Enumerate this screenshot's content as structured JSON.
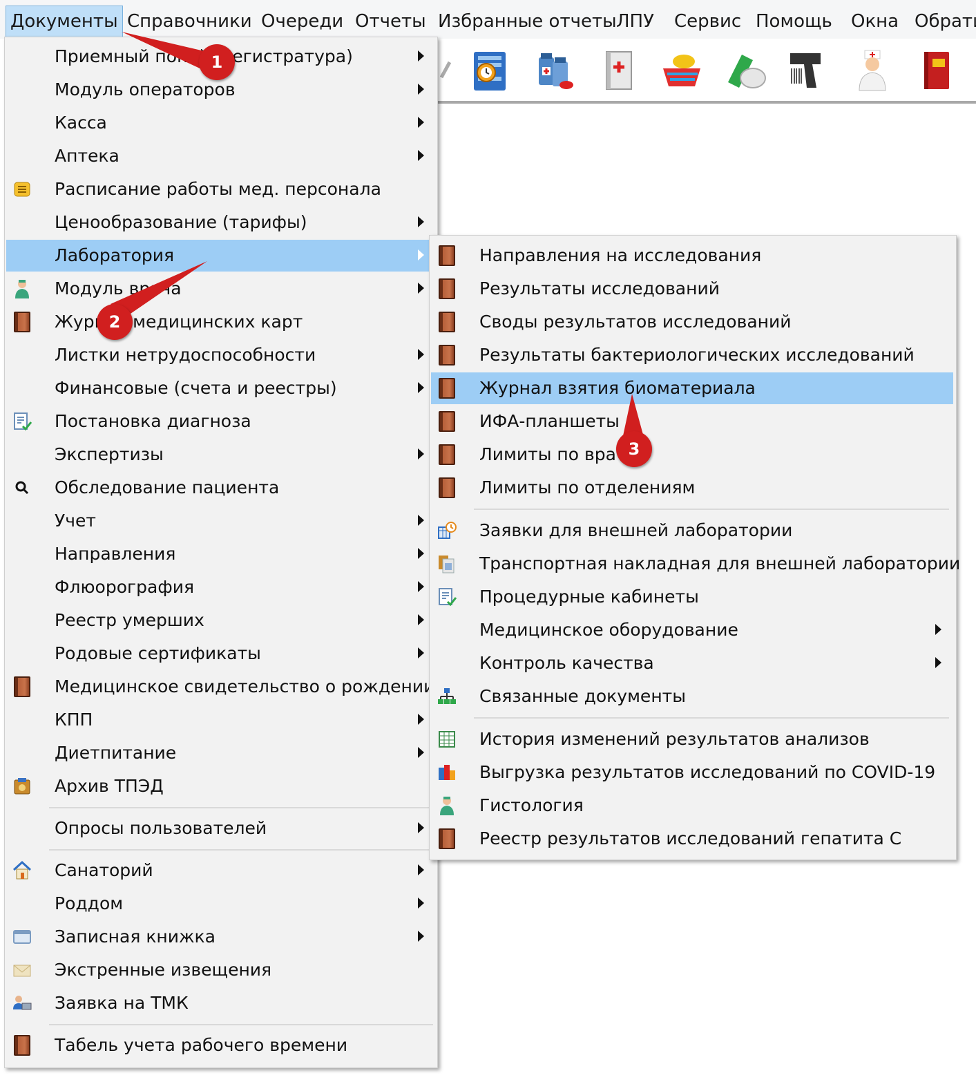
{
  "menubar": {
    "items": [
      "Документы",
      "Справочники",
      "Очереди",
      "Отчеты",
      "Избранные отчеты",
      "ЛПУ",
      "Сервис",
      "Помощь",
      "Окна",
      "Обрати"
    ]
  },
  "toolbar": {
    "icons": [
      "schedule-clock-icon",
      "medicine-bottles-icon",
      "medical-book-icon",
      "basket-pills-icon",
      "pills-icon",
      "barcode-scanner-icon",
      "nurse-icon",
      "red-document-icon"
    ]
  },
  "main_menu": {
    "items": [
      {
        "label": "Приемный покой (регистратура)",
        "icon": "",
        "submenu": true
      },
      {
        "label": "Модуль операторов",
        "icon": "",
        "submenu": true
      },
      {
        "label": "Касса",
        "icon": "",
        "submenu": true
      },
      {
        "label": "Аптека",
        "icon": "",
        "submenu": true
      },
      {
        "label": "Расписание работы мед. персонала",
        "icon": "schedule-list-icon",
        "submenu": false
      },
      {
        "label": "Ценообразование (тарифы)",
        "icon": "",
        "submenu": true
      },
      {
        "label": "Лаборатория",
        "icon": "",
        "submenu": true,
        "highlighted": true
      },
      {
        "label": "Модуль врача",
        "icon": "doctor-icon",
        "submenu": true
      },
      {
        "label": "Журнал медицинских карт",
        "icon": "book-icon",
        "submenu": false
      },
      {
        "label": "Листки нетрудоспособности",
        "icon": "",
        "submenu": true
      },
      {
        "label": "Финансовые (счета и реестры)",
        "icon": "",
        "submenu": true
      },
      {
        "label": "Постановка диагноза",
        "icon": "checklist-icon",
        "submenu": false
      },
      {
        "label": "Экспертизы",
        "icon": "",
        "submenu": true
      },
      {
        "label": "Обследование пациента",
        "icon": "search-icon",
        "submenu": false
      },
      {
        "label": "Учет",
        "icon": "",
        "submenu": true
      },
      {
        "label": "Направления",
        "icon": "",
        "submenu": true
      },
      {
        "label": "Флюорография",
        "icon": "",
        "submenu": true
      },
      {
        "label": "Реестр умерших",
        "icon": "",
        "submenu": true
      },
      {
        "label": "Родовые сертификаты",
        "icon": "",
        "submenu": true
      },
      {
        "label": "Медицинское свидетельство о рождении",
        "icon": "book-icon",
        "submenu": false
      },
      {
        "label": "КПП",
        "icon": "",
        "submenu": true
      },
      {
        "label": "Диетпитание",
        "icon": "",
        "submenu": true
      },
      {
        "label": "Архив ТПЭД",
        "icon": "archive-icon",
        "submenu": false
      },
      {
        "label": "Опросы пользователей",
        "icon": "",
        "submenu": true
      },
      {
        "label": "Санаторий",
        "icon": "house-icon",
        "submenu": true
      },
      {
        "label": "Роддом",
        "icon": "",
        "submenu": true
      },
      {
        "label": "Записная книжка",
        "icon": "notebook-icon",
        "submenu": true
      },
      {
        "label": "Экстренные извещения",
        "icon": "envelope-icon",
        "submenu": false
      },
      {
        "label": "Заявка на ТМК",
        "icon": "users-computer-icon",
        "submenu": false
      },
      {
        "label": "Табель учета рабочего времени",
        "icon": "book-icon",
        "submenu": false
      }
    ]
  },
  "sub_menu": {
    "items": [
      {
        "label": "Направления на исследования",
        "icon": "book-icon",
        "submenu": false
      },
      {
        "label": "Результаты исследований",
        "icon": "book-icon",
        "submenu": false
      },
      {
        "label": "Своды результатов исследований",
        "icon": "book-icon",
        "submenu": false
      },
      {
        "label": "Результаты бактериологических исследований",
        "icon": "book-icon",
        "submenu": false
      },
      {
        "label": "Журнал взятия биоматериала",
        "icon": "book-icon",
        "submenu": false,
        "highlighted": true
      },
      {
        "label": "ИФА-планшеты",
        "icon": "book-icon",
        "submenu": false
      },
      {
        "label": "Лимиты по врачам",
        "icon": "book-icon",
        "submenu": false
      },
      {
        "label": "Лимиты по отделениям",
        "icon": "book-icon",
        "submenu": false
      },
      {
        "label": "Заявки для внешней лаборатории",
        "icon": "calendar-clock-icon",
        "submenu": false
      },
      {
        "label": "Транспортная накладная для внешней лаборатории",
        "icon": "documents-icon",
        "submenu": false
      },
      {
        "label": "Процедурные кабинеты",
        "icon": "checklist-icon",
        "submenu": false
      },
      {
        "label": "Медицинское оборудование",
        "icon": "",
        "submenu": true
      },
      {
        "label": "Контроль качества",
        "icon": "",
        "submenu": true
      },
      {
        "label": "Связанные документы",
        "icon": "hierarchy-icon",
        "submenu": false
      },
      {
        "label": "История изменений результатов анализов",
        "icon": "table-icon",
        "submenu": false
      },
      {
        "label": "Выгрузка результатов исследований по COVID-19",
        "icon": "export-icon",
        "submenu": false
      },
      {
        "label": "Гистология",
        "icon": "doctor-icon",
        "submenu": false
      },
      {
        "label": "Реестр результатов исследований гепатита С",
        "icon": "book-icon",
        "submenu": false
      }
    ]
  },
  "annotations": [
    "1",
    "2",
    "3"
  ],
  "colors": {
    "highlight": "#9dcdf5",
    "menubar_active": "#bfdff8",
    "callout": "#d11f1f"
  }
}
